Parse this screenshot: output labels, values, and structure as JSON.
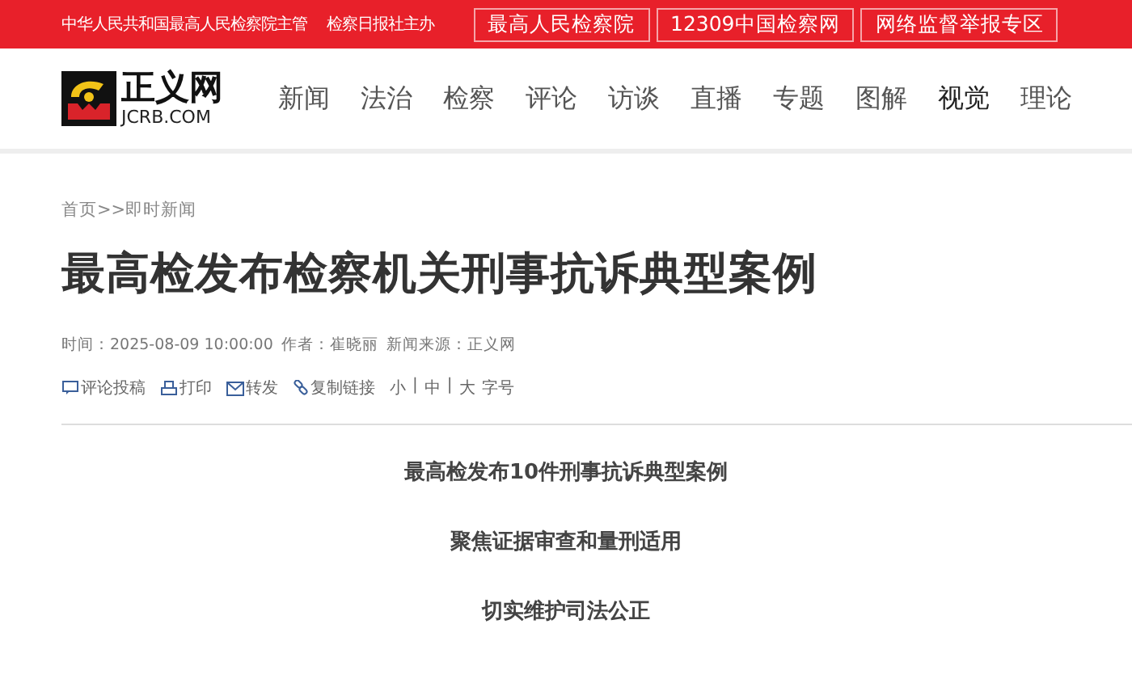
{
  "top_bar": {
    "notes": [
      "中华人民共和国最高人民检察院主管",
      "检察日报社主办"
    ],
    "links": [
      "最高人民检察院",
      "12309中国检察网",
      "网络监督举报专区"
    ]
  },
  "logo": {
    "name": "正义网",
    "domain": "JCRB.COM"
  },
  "nav": [
    {
      "label": "新闻",
      "selected": false
    },
    {
      "label": "法治",
      "selected": false
    },
    {
      "label": "检察",
      "selected": false
    },
    {
      "label": "评论",
      "selected": false
    },
    {
      "label": "访谈",
      "selected": false
    },
    {
      "label": "直播",
      "selected": false
    },
    {
      "label": "专题",
      "selected": false
    },
    {
      "label": "图解",
      "selected": false
    },
    {
      "label": "视觉",
      "selected": true
    },
    {
      "label": "理论",
      "selected": false
    }
  ],
  "breadcrumb": "首页>>即时新闻",
  "article": {
    "title": "最高检发布检察机关刑事抗诉典型案例",
    "meta": [
      "时间：2025-08-09 10:00:00",
      "作者：崔晓丽",
      "新闻来源：正义网"
    ],
    "tools": [
      {
        "kind": "comment",
        "label": "评论投稿"
      },
      {
        "kind": "print",
        "label": "打印"
      },
      {
        "kind": "mail",
        "label": "转发"
      },
      {
        "kind": "link",
        "label": "复制链接"
      }
    ],
    "font_size": {
      "options": [
        "小",
        "中",
        "大"
      ],
      "separator": "|",
      "label": "字号"
    },
    "headings": [
      "最高检发布10件刑事抗诉典型案例",
      "聚焦证据审查和量刑适用",
      "切实维护司法公正"
    ]
  }
}
